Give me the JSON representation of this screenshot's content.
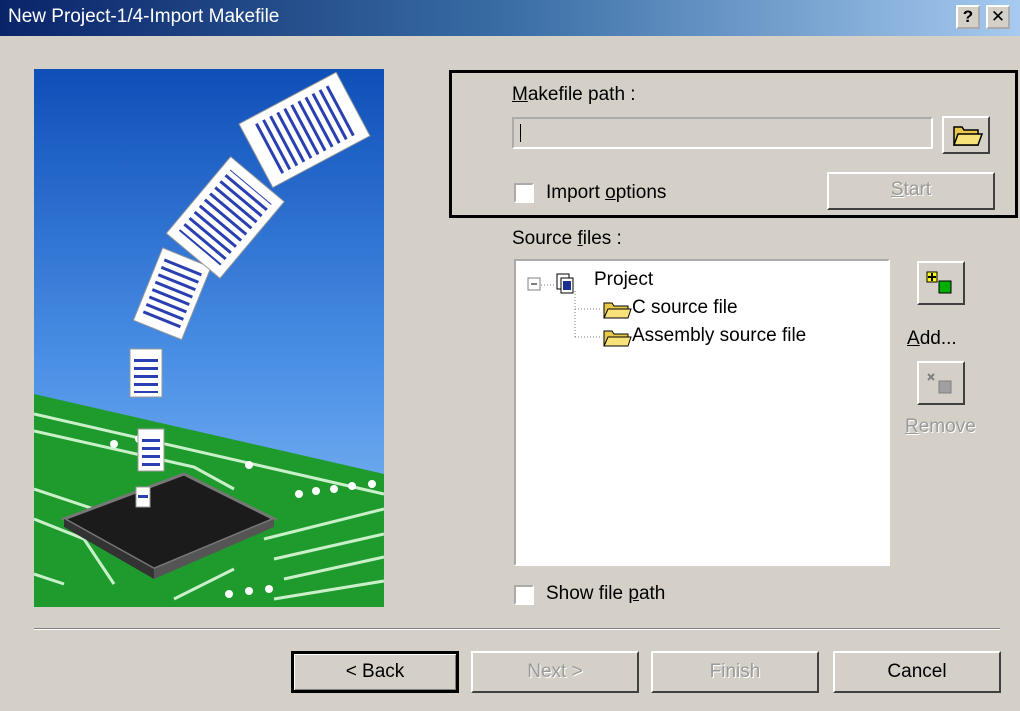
{
  "window": {
    "title": "New Project-1/4-Import Makefile",
    "help_label": "?",
    "close_label": "✕"
  },
  "makefile": {
    "label_accel": "M",
    "label_rest": "akefile path :",
    "value": "",
    "import_options_pre": "Import ",
    "import_options_accel": "o",
    "import_options_post": "ptions",
    "import_options_checked": false,
    "start_accel": "S",
    "start_rest": "tart",
    "start_enabled": false
  },
  "source_files": {
    "label_pre": "Source ",
    "label_accel": "f",
    "label_post": "iles :",
    "tree": {
      "root": "Project",
      "expander": "⊟",
      "children": [
        "C source file",
        "Assembly source file"
      ]
    },
    "add_accel": "A",
    "add_rest": "dd...",
    "remove_accel": "R",
    "remove_rest": "emove",
    "show_path_pre": "Show file ",
    "show_path_accel": "p",
    "show_path_post": "ath",
    "show_path_checked": false
  },
  "footer": {
    "back": "< Back",
    "next": "Next >",
    "finish": "Finish",
    "cancel": "Cancel"
  },
  "colors": {
    "titlebar_start": "#0a246a",
    "titlebar_end": "#a6caf0",
    "dialog_bg": "#d4d0c8",
    "highlight_border": "#000000"
  }
}
